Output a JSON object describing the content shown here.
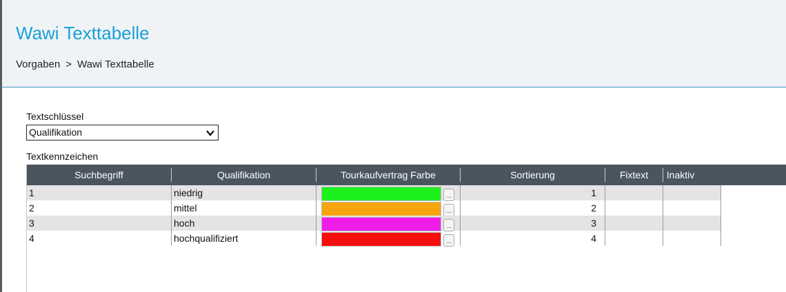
{
  "header": {
    "title": "Wawi Texttabelle",
    "breadcrumb": [
      "Vorgaben",
      ">",
      "Wawi Texttabelle"
    ]
  },
  "form": {
    "key_label": "Textschlüssel",
    "key_value": "Qualifikation",
    "table_label": "Textkennzeichen"
  },
  "table": {
    "columns": [
      "Suchbegriff",
      "Qualifikation",
      "Tourkaufvertrag Farbe",
      "Sortierung",
      "Fixtext",
      "Inaktiv"
    ],
    "rows": [
      {
        "suchbegriff": "1",
        "qualifikation": "niedrig",
        "farbe": "#1ef01e",
        "sortierung": "1"
      },
      {
        "suchbegriff": "2",
        "qualifikation": "mittel",
        "farbe": "#f7a50f",
        "sortierung": "2"
      },
      {
        "suchbegriff": "3",
        "qualifikation": "hoch",
        "farbe": "#ee1ee8",
        "sortierung": "3"
      },
      {
        "suchbegriff": "4",
        "qualifikation": "hochqualifiziert",
        "farbe": "#f50f0f",
        "sortierung": "4"
      }
    ],
    "button_label": "..."
  },
  "colors": {
    "title": "#1aa0d8",
    "header_bg": "#f0f3f5",
    "table_header_bg": "#4a5560"
  }
}
